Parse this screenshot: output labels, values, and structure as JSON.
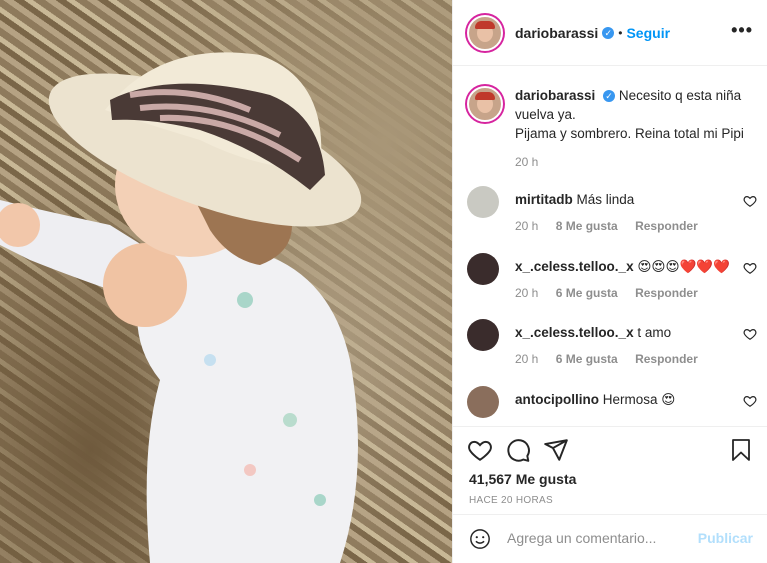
{
  "header": {
    "username": "dariobarassi",
    "verified_mark": "✓",
    "separator": "•",
    "follow_label": "Seguir",
    "more_icon": "more-horizontal-icon",
    "more_glyph": "•••"
  },
  "caption": {
    "username": "dariobarassi",
    "line1": "Necesito q esta niña vuelva ya.",
    "line2": "Pijama y sombrero. Reina total mi Pipi",
    "time": "20 h"
  },
  "comments": [
    {
      "username": "mirtitadb",
      "text": "Más linda",
      "time": "20 h",
      "likes": "8 Me gusta",
      "reply": "Responder"
    },
    {
      "username": "x_.celess.telloo._x",
      "text": "😍😍😍❤️❤️❤️",
      "time": "20 h",
      "likes": "6 Me gusta",
      "reply": "Responder"
    },
    {
      "username": "x_.celess.telloo._x",
      "text": "t amo",
      "time": "20 h",
      "likes": "6 Me gusta",
      "reply": "Responder"
    },
    {
      "username": "antocipollino",
      "text": "Hermosa 😍",
      "time": "",
      "likes": "",
      "reply": ""
    }
  ],
  "actions": {
    "likes": "41,567 Me gusta",
    "timestamp": "HACE 20 HORAS"
  },
  "add_comment": {
    "placeholder": "Agrega un comentario...",
    "publish_label": "Publicar"
  },
  "colors": {
    "accent": "#0095f6",
    "publish_disabled": "#b2dffc",
    "secondary_text": "#8e8e8e",
    "divider": "#efefef"
  }
}
